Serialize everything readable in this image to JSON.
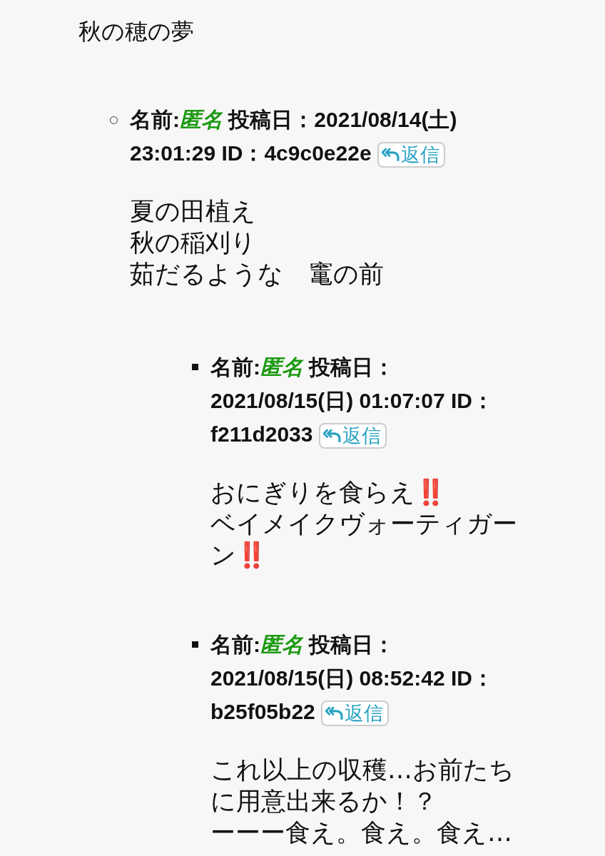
{
  "title": "秋の穂の夢",
  "posts": [
    {
      "name_label": "名前:",
      "name": "匿名",
      "date_label": "投稿日：",
      "date": "2021/08/14(土)",
      "time": "23:01:29",
      "id_label": "ID：",
      "id": "4c9c0e22e",
      "reply": "返信",
      "body": [
        "夏の田植え",
        "秋の稲刈り",
        "茹だるような　竃の前"
      ],
      "children": [
        {
          "name_label": "名前:",
          "name": "匿名",
          "date_label": "投稿日：",
          "date": "2021/08/15(日)",
          "time": "01:07:07",
          "id_label": "ID：",
          "id": "f211d2033",
          "reply": "返信",
          "body": [
            "おにぎりを食らえ‼️",
            "ベイメイクヴォーティガーン‼️"
          ]
        },
        {
          "name_label": "名前:",
          "name": "匿名",
          "date_label": "投稿日：",
          "date": "2021/08/15(日)",
          "time": "08:52:42",
          "id_label": "ID：",
          "id": "b25f05b22",
          "reply": "返信",
          "body": [
            "これ以上の収穫…お前たちに用意出来るか！？",
            "ーーー食え。食え。食え…"
          ]
        }
      ]
    }
  ]
}
